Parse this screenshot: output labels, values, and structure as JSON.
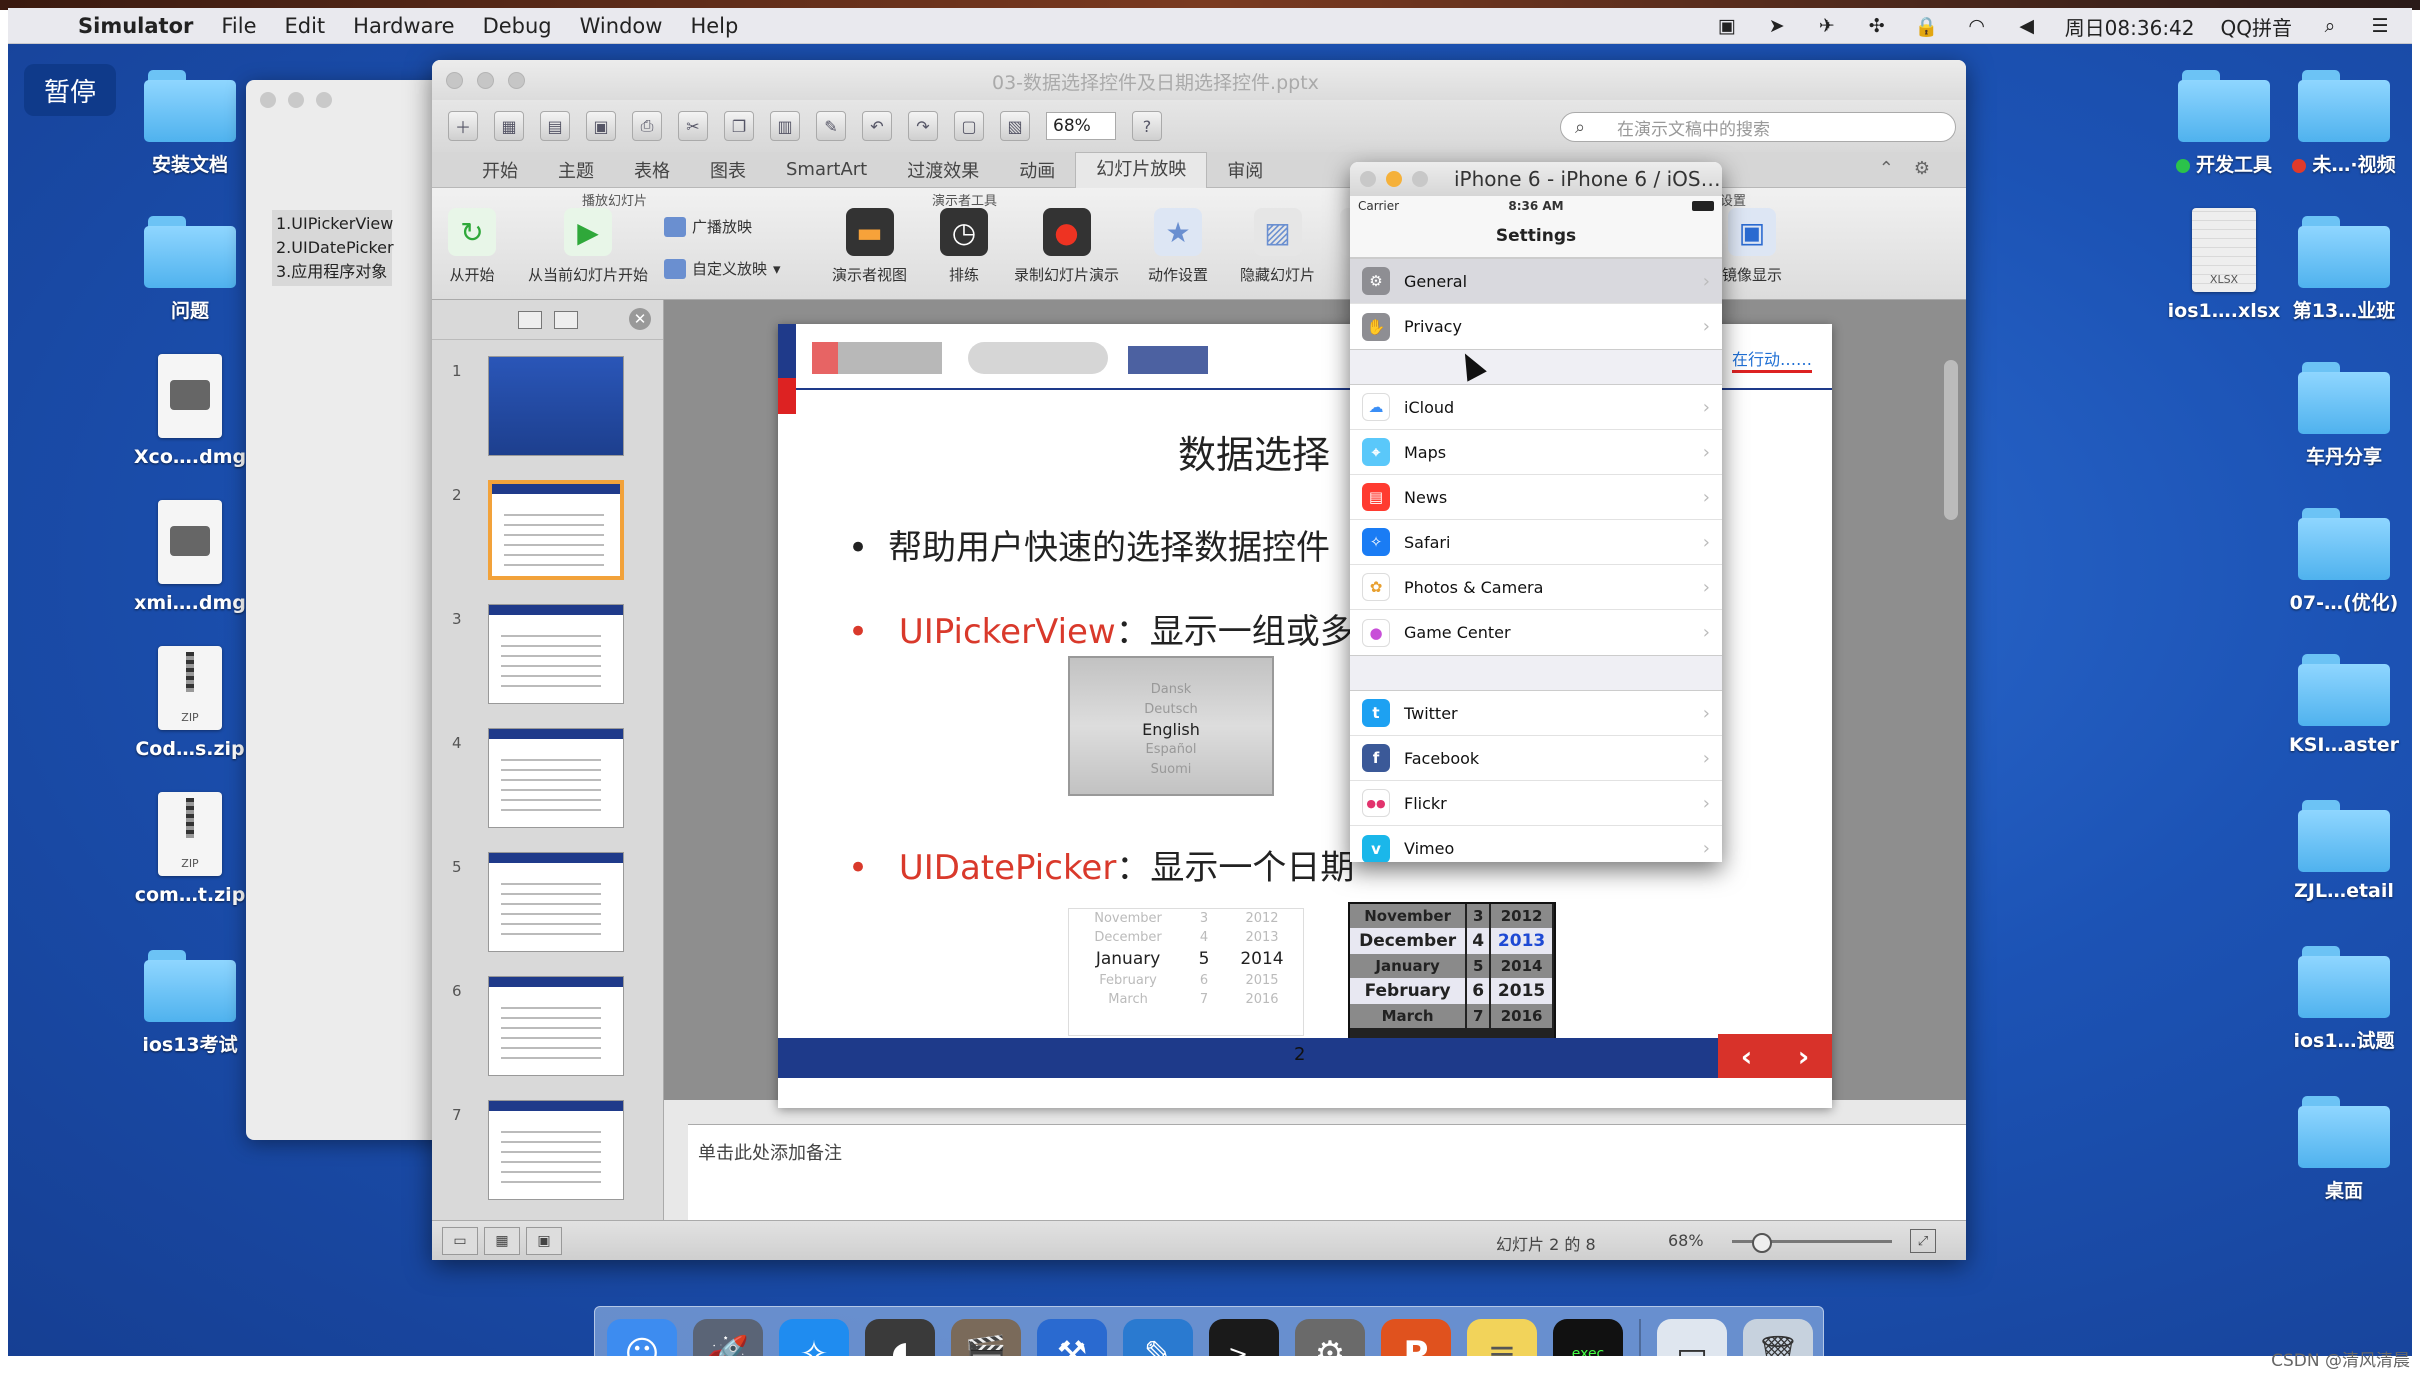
{
  "menubar": {
    "app_name": "Simulator",
    "items": [
      "File",
      "Edit",
      "Hardware",
      "Debug",
      "Window",
      "Help"
    ],
    "clock": "周日08:36:42",
    "input_method": "QQ拼音"
  },
  "desktop": {
    "pause_label": "暂停",
    "left_icons": [
      {
        "label": "安装文档",
        "type": "folder"
      },
      {
        "label": "问题",
        "type": "folder"
      },
      {
        "label": "Xco….dmg",
        "type": "dmg"
      },
      {
        "label": "xmi….dmg",
        "type": "dmg"
      },
      {
        "label": "Cod…s.zip",
        "type": "zip"
      },
      {
        "label": "com…t.zip",
        "type": "zip"
      },
      {
        "label": "ios13考试",
        "type": "folder"
      }
    ],
    "right_col1": [
      {
        "label": "开发工具",
        "type": "folder",
        "dot": "#2bc24a"
      },
      {
        "label": "ios1….xlsx",
        "type": "xlsx"
      }
    ],
    "right_col2": [
      {
        "label": "未…·视频",
        "type": "folder",
        "dot": "#e03a2a"
      },
      {
        "label": "第13…业班",
        "type": "folder"
      },
      {
        "label": "车丹分享",
        "type": "folder"
      },
      {
        "label": "07-…(优化)",
        "type": "folder"
      },
      {
        "label": "KSI…aster",
        "type": "folder"
      },
      {
        "label": "ZJL…etail",
        "type": "folder"
      },
      {
        "label": "ios1…试题",
        "type": "folder"
      },
      {
        "label": "桌面",
        "type": "folder"
      }
    ]
  },
  "finder": {
    "outline": [
      "1.UIPickerView",
      "2.UIDatePicker",
      "3.应用程序对象"
    ]
  },
  "ppt": {
    "title": "03-数据选择控件及日期选择控件.pptx",
    "zoom": "68%",
    "search_placeholder": "在演示文稿中的搜索",
    "tabs": [
      "开始",
      "主题",
      "表格",
      "图表",
      "SmartArt",
      "过渡效果",
      "动画",
      "幻灯片放映",
      "审阅"
    ],
    "active_tab": "幻灯片放映",
    "ribbon": {
      "group_play": "播放幻灯片",
      "group_presenter": "演示者工具",
      "group_settings": "设置",
      "btn_from_start": "从开始",
      "btn_from_current": "从当前幻灯片开始",
      "btn_broadcast": "广播放映",
      "btn_custom": "自定义放映",
      "btn_presenter_view": "演示者视图",
      "btn_rehearse": "排练",
      "btn_record": "录制幻灯片演示",
      "btn_action": "动作设置",
      "btn_hide": "隐藏幻灯片",
      "btn_set": "设",
      "btn_mirror": "镜像显示"
    },
    "thumb_numbers": [
      "1",
      "2",
      "3",
      "4",
      "5",
      "6",
      "7"
    ],
    "slide": {
      "header_tag": "在行动……",
      "title": "数据选择",
      "bullet1": "帮助用户快速的选择数据控件",
      "bullet2_name": "UIPickerView",
      "bullet2_text": "：显示一组或多",
      "bullet3_name": "UIDatePicker",
      "bullet3_text": "：显示一个日期",
      "picker_items": [
        "Dansk",
        "Deutsch",
        "English",
        "Español",
        "Suomi"
      ],
      "date_light_rows": [
        [
          "November",
          "3",
          "2012"
        ],
        [
          "December",
          "4",
          "2013"
        ],
        [
          "January",
          "5",
          "2014"
        ],
        [
          "February",
          "6",
          "2015"
        ],
        [
          "March",
          "7",
          "2016"
        ]
      ],
      "date_dark_rows": [
        [
          "November",
          "3",
          "2012"
        ],
        [
          "December",
          "4",
          "2013"
        ],
        [
          "January",
          "5",
          "2014"
        ],
        [
          "February",
          "6",
          "2015"
        ],
        [
          "March",
          "7",
          "2016"
        ]
      ],
      "page_number": "2",
      "nav_prev": "‹",
      "nav_next": "›"
    },
    "notes_placeholder": "单击此处添加备注",
    "status_slide": "幻灯片 2 的 8",
    "status_zoom": "68%"
  },
  "simulator": {
    "title": "iPhone 6 - iPhone 6 / iOS…",
    "carrier": "Carrier",
    "time": "8:36 AM",
    "nav_title": "Settings",
    "groups": [
      [
        {
          "label": "General",
          "icon": "gear-icon",
          "color": "#8e8e93",
          "glyph": "⚙"
        },
        {
          "label": "Privacy",
          "icon": "hand-icon",
          "color": "#8e8e93",
          "glyph": "✋"
        }
      ],
      [
        {
          "label": "iCloud",
          "icon": "cloud-icon",
          "color": "#ffffff",
          "glyph": "☁"
        },
        {
          "label": "Maps",
          "icon": "map-icon",
          "color": "#5ac8fa",
          "glyph": "⌖"
        },
        {
          "label": "News",
          "icon": "news-icon",
          "color": "#ff3b30",
          "glyph": "▤"
        },
        {
          "label": "Safari",
          "icon": "compass-icon",
          "color": "#1a7cf4",
          "glyph": "✧"
        },
        {
          "label": "Photos & Camera",
          "icon": "photos-icon",
          "color": "#ffffff",
          "glyph": "✿"
        },
        {
          "label": "Game Center",
          "icon": "bubbles-icon",
          "color": "#ffffff",
          "glyph": "●"
        }
      ],
      [
        {
          "label": "Twitter",
          "icon": "twitter-icon",
          "color": "#1da1f2",
          "glyph": "t"
        },
        {
          "label": "Facebook",
          "icon": "facebook-icon",
          "color": "#3b5998",
          "glyph": "f"
        },
        {
          "label": "Flickr",
          "icon": "flickr-icon",
          "color": "#ffffff",
          "glyph": "●●"
        },
        {
          "label": "Vimeo",
          "icon": "vimeo-icon",
          "color": "#1ab7ea",
          "glyph": "v"
        }
      ]
    ]
  },
  "dock": {
    "items": [
      {
        "name": "finder-icon",
        "glyph": "☺",
        "color": "#3d8cf0",
        "running": true
      },
      {
        "name": "launchpad-icon",
        "glyph": "🚀",
        "color": "#5a6476",
        "running": false
      },
      {
        "name": "safari-icon",
        "glyph": "✧",
        "color": "#1f8cf0",
        "running": false
      },
      {
        "name": "mouse-icon",
        "glyph": "◖",
        "color": "#3a3a3a",
        "running": true
      },
      {
        "name": "movie-icon",
        "glyph": "🎬",
        "color": "#7a6a5a",
        "running": true
      },
      {
        "name": "xcode-icon",
        "glyph": "⚒",
        "color": "#2a6ad0",
        "running": false
      },
      {
        "name": "instruments-icon",
        "glyph": "✎",
        "color": "#2a7ad0",
        "running": true
      },
      {
        "name": "terminal-icon",
        "glyph": ">_",
        "color": "#1a1a1a",
        "running": false
      },
      {
        "name": "system-preferences-icon",
        "glyph": "⚙",
        "color": "#6a6a6a",
        "running": false
      },
      {
        "name": "powerpoint-icon",
        "glyph": "P",
        "color": "#e0521e",
        "running": true
      },
      {
        "name": "notes-icon",
        "glyph": "≡",
        "color": "#f2d35a",
        "running": true
      },
      {
        "name": "exec-icon",
        "glyph": "exec",
        "color": "#111111",
        "running": false
      }
    ],
    "trash_items": [
      {
        "name": "preview-icon",
        "glyph": "▭",
        "color": "#dfe6ef"
      },
      {
        "name": "trash-icon",
        "glyph": "🗑",
        "color": "#c7d2de"
      }
    ]
  },
  "watermark": "CSDN @清风清晨"
}
